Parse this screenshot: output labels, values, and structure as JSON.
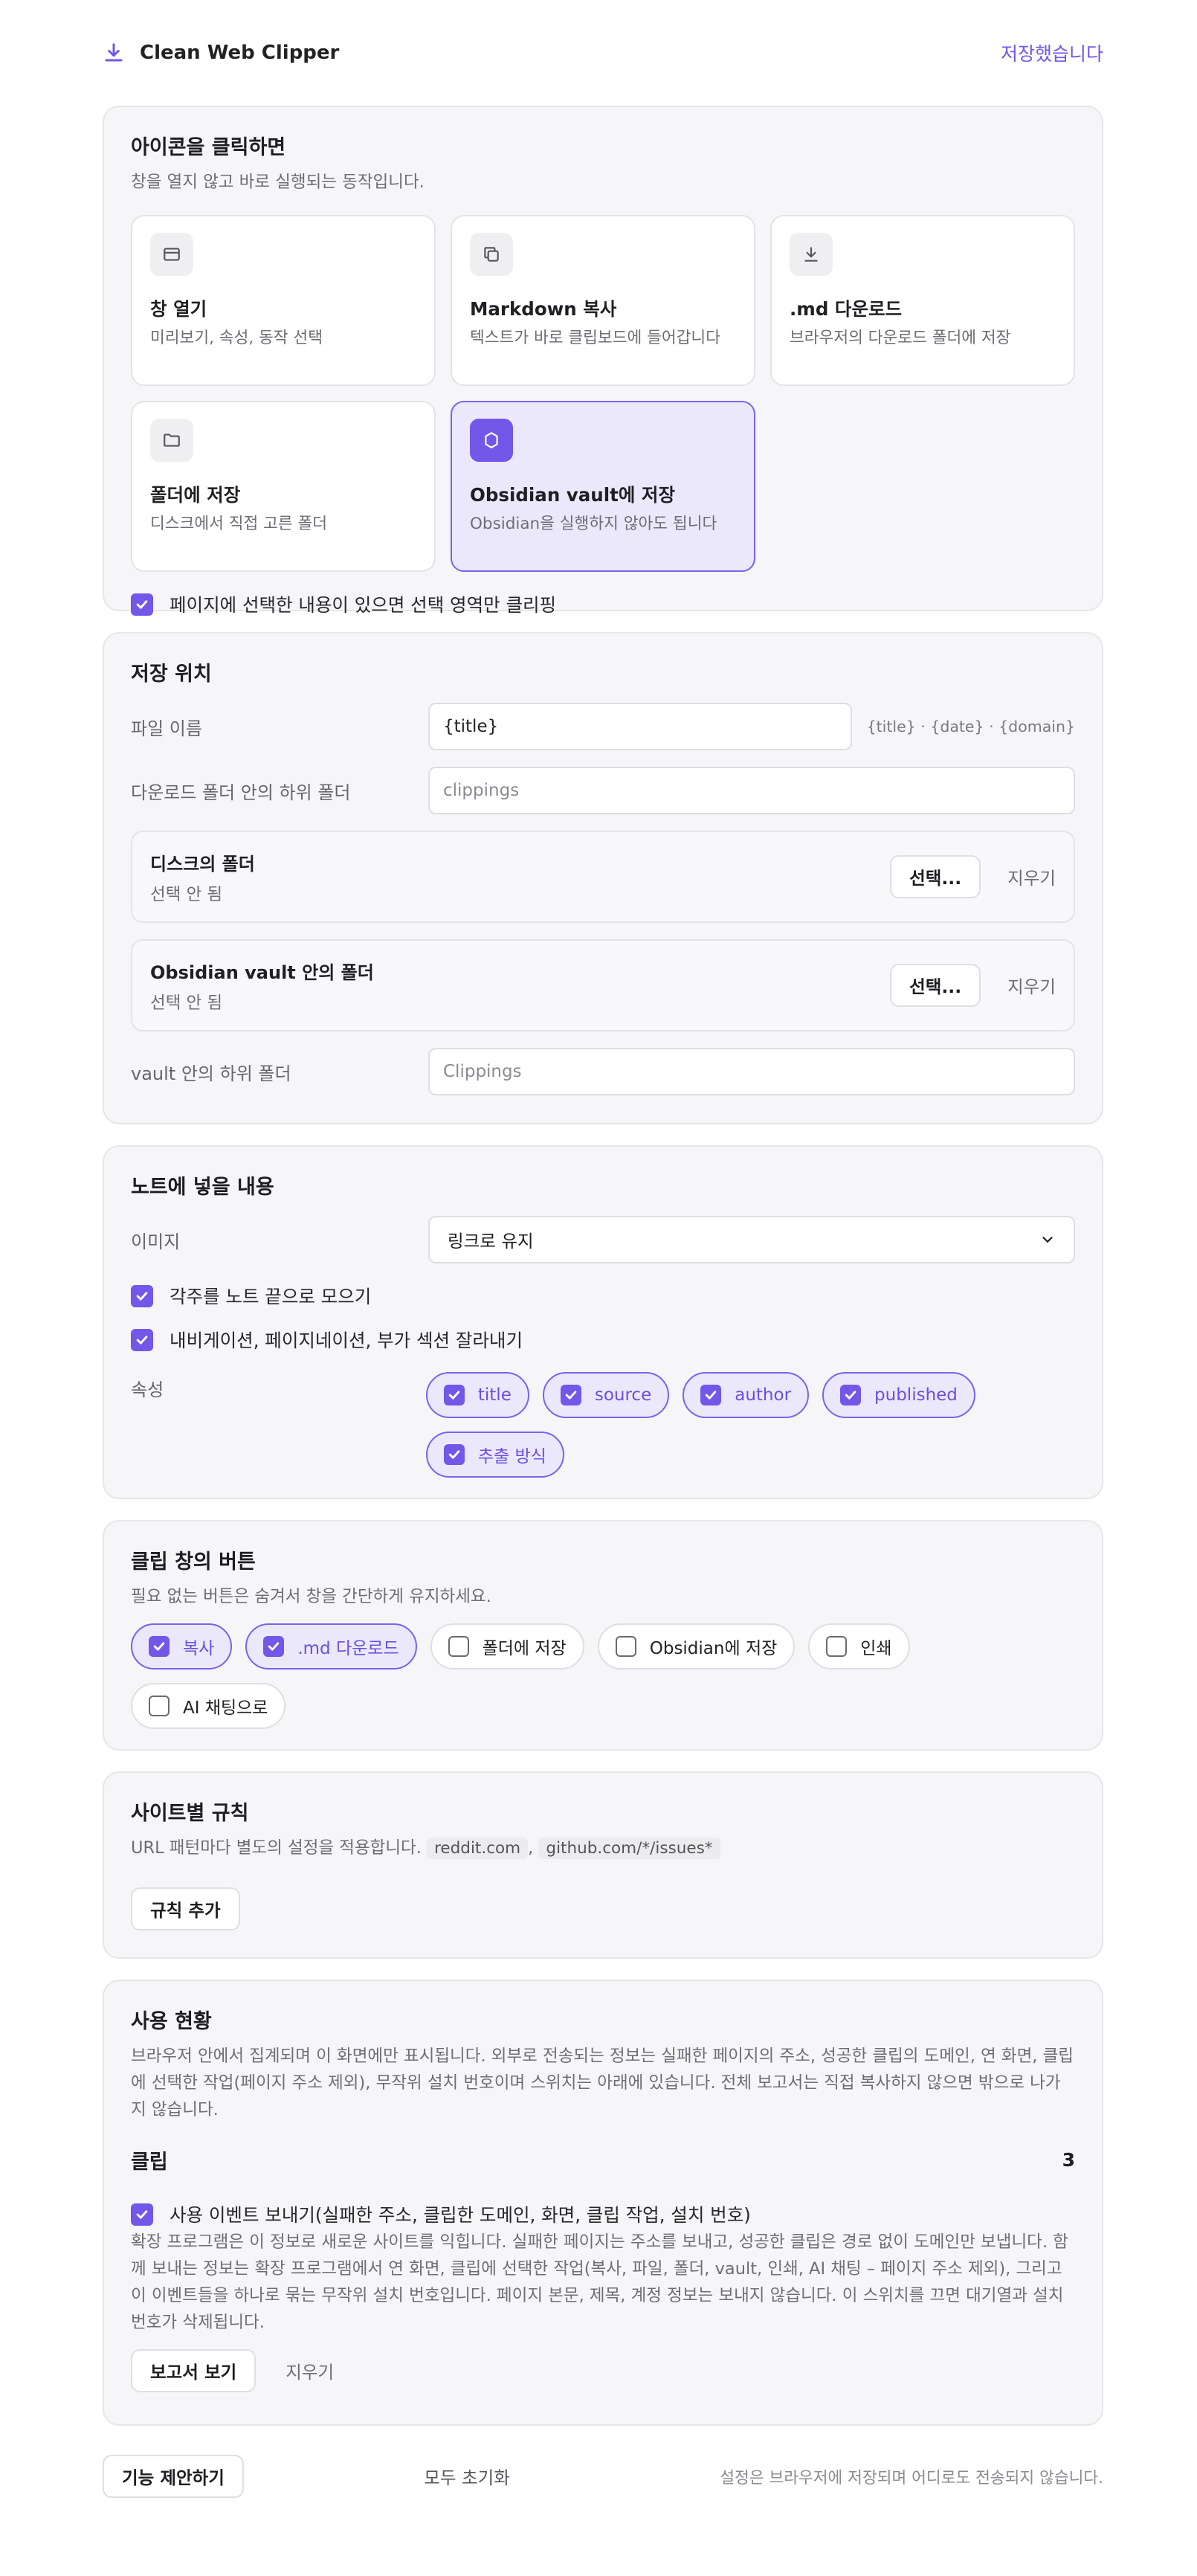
{
  "app": {
    "title": "Clean Web Clipper",
    "saved_status": "저장했습니다"
  },
  "click_action": {
    "title": "아이콘을 클릭하면",
    "subtitle": "창을 열지 않고 바로 실행되는 동작입니다.",
    "options": [
      {
        "label": "창 열기",
        "desc": "미리보기, 속성, 동작 선택",
        "icon": "window-icon",
        "selected": false
      },
      {
        "label": "Markdown 복사",
        "desc": "텍스트가 바로 클립보드에 들어갑니다",
        "icon": "copy-icon",
        "selected": false
      },
      {
        "label": ".md 다운로드",
        "desc": "브라우저의 다운로드 폴더에 저장",
        "icon": "download-icon",
        "selected": false
      },
      {
        "label": "폴더에 저장",
        "desc": "디스크에서 직접 고른 폴더",
        "icon": "folder-icon",
        "selected": false
      },
      {
        "label": "Obsidian vault에 저장",
        "desc": "Obsidian을 실행하지 않아도 됩니다",
        "icon": "obsidian-icon",
        "selected": true
      }
    ],
    "selection_only": {
      "label": "페이지에 선택한 내용이 있으면 선택 영역만 클리핑",
      "checked": true
    }
  },
  "save_location": {
    "title": "저장 위치",
    "filename_label": "파일 이름",
    "filename_value": "{title}",
    "filename_hint": "{title} · {date} · {domain}",
    "subfolder_label": "다운로드 폴더 안의 하위 폴더",
    "subfolder_placeholder": "clippings",
    "disk_folder": {
      "title": "디스크의 폴더",
      "status": "선택 안 됨",
      "select_label": "선택...",
      "clear_label": "지우기"
    },
    "vault_folder": {
      "title": "Obsidian vault 안의 폴더",
      "status": "선택 안 됨",
      "select_label": "선택...",
      "clear_label": "지우기"
    },
    "vault_subfolder_label": "vault 안의 하위 폴더",
    "vault_subfolder_placeholder": "Clippings"
  },
  "note_content": {
    "title": "노트에 넣을 내용",
    "image_label": "이미지",
    "image_value": "링크로 유지",
    "footnotes": {
      "label": "각주를 노트 끝으로 모으기",
      "checked": true
    },
    "strip": {
      "label": "내비게이션, 페이지네이션, 부가 섹션 잘라내기",
      "checked": true
    },
    "props_label": "속성",
    "props": [
      {
        "label": "title",
        "checked": true
      },
      {
        "label": "source",
        "checked": true
      },
      {
        "label": "author",
        "checked": true
      },
      {
        "label": "published",
        "checked": true
      },
      {
        "label": "추출 방식",
        "checked": true
      }
    ]
  },
  "buttons": {
    "title": "클립 창의 버튼",
    "subtitle": "필요 없는 버튼은 숨겨서 창을 간단하게 유지하세요.",
    "items": [
      {
        "label": "복사",
        "checked": true
      },
      {
        "label": ".md 다운로드",
        "checked": true
      },
      {
        "label": "폴더에 저장",
        "checked": false
      },
      {
        "label": "Obsidian에 저장",
        "checked": false
      },
      {
        "label": "인쇄",
        "checked": false
      },
      {
        "label": "AI 채팅으로",
        "checked": false
      }
    ]
  },
  "site_rules": {
    "title": "사이트별 규칙",
    "subtitle": "URL 패턴마다 별도의 설정을 적용합니다.",
    "example1": "reddit.com",
    "sep": ",",
    "example2": "github.com/*/issues*",
    "add_label": "규칙 추가"
  },
  "usage": {
    "title": "사용 현황",
    "desc": "브라우저 안에서 집계되며 이 화면에만 표시됩니다. 외부로 전송되는 정보는 실패한 페이지의 주소, 성공한 클립의 도메인, 연 화면, 클립에 선택한 작업(페이지 주소 제외), 무작위 설치 번호이며 스위치는 아래에 있습니다. 전체 보고서는 직접 복사하지 않으면 밖으로 나가지 않습니다.",
    "clips_label": "클립",
    "clips_count": "3",
    "send": {
      "label": "사용 이벤트 보내기(실패한 주소, 클립한 도메인, 화면, 클립 작업, 설치 번호)",
      "checked": true
    },
    "send_desc": "확장 프로그램은 이 정보로 새로운 사이트를 익힙니다. 실패한 페이지는 주소를 보내고, 성공한 클립은 경로 없이 도메인만 보냅니다. 함께 보내는 정보는 확장 프로그램에서 연 화면, 클립에 선택한 작업(복사, 파일, 폴더, vault, 인쇄, AI 채팅 – 페이지 주소 제외), 그리고 이 이벤트들을 하나로 묶는 무작위 설치 번호입니다. 페이지 본문, 제목, 계정 정보는 보내지 않습니다. 이 스위치를 끄면 대기열과 설치 번호가 삭제됩니다.",
    "report_label": "보고서 보기",
    "clear_label": "지우기"
  },
  "footer": {
    "suggest_label": "기능 제안하기",
    "reset_label": "모두 초기화",
    "note": "설정은 브라우저에 저장되며 어디로도 전송되지 않습니다."
  },
  "colors": {
    "accent": "#7257e8",
    "accent_bg": "#ece8fb",
    "card_bg": "#f6f6f8"
  }
}
